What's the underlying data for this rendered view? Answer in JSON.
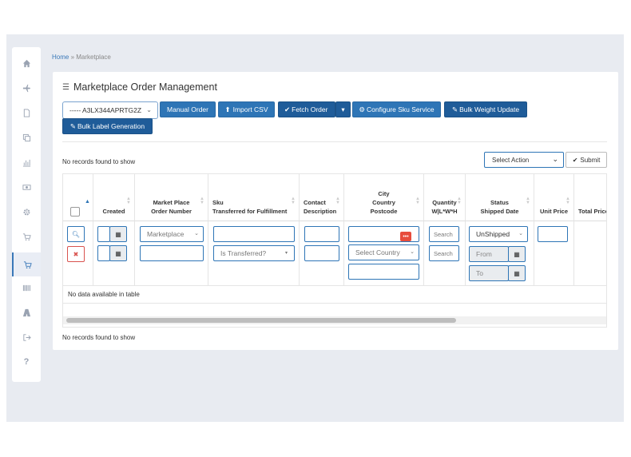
{
  "breadcrumb": {
    "home": "Home",
    "separator": "»",
    "current": "Marketplace"
  },
  "page": {
    "title": "Marketplace Order Management"
  },
  "toolbar": {
    "store_select": "----- A3LX344APRTG2Z",
    "manual_order": "Manual Order",
    "import_csv": "Import CSV",
    "fetch_order": "Fetch Order",
    "configure_sku": "Configure Sku Service",
    "bulk_weight": "Bulk Weight Update",
    "bulk_label": "Bulk Label Generation"
  },
  "records_top": "No records found to show",
  "records_bottom": "No records found to show",
  "actions": {
    "select_action": "Select Action",
    "submit": "Submit"
  },
  "table": {
    "headers": {
      "created": "Created",
      "mp_line1": "Market Place",
      "mp_line2": "Order Number",
      "sku_line1": "Sku",
      "sku_line2": "Transferred for Fulfillment",
      "contact_line1": "Contact",
      "contact_line2": "Description",
      "city_line1": "City",
      "city_line2": "Country",
      "city_line3": "Postcode",
      "qty_line1": "Quantity",
      "qty_line2": "W|L*W*H",
      "status_line1": "Status",
      "status_line2": "Shipped Date",
      "unit_price": "Unit Price",
      "total_price": "Total Price"
    },
    "filters": {
      "marketplace": "Marketplace",
      "transferred": "Is Transferred?",
      "country": "Select Country",
      "search": "Search",
      "status": "UnShipped",
      "from": "From",
      "to": "To"
    },
    "empty": "No data available in table"
  },
  "icons": {
    "search": "search-icon",
    "clear": "close-icon",
    "calendar": "calendar-icon"
  },
  "colors": {
    "primary": "#2e75b6",
    "primary_dark": "#1f5c99",
    "danger": "#d9534f",
    "background": "#e8ebf1"
  }
}
